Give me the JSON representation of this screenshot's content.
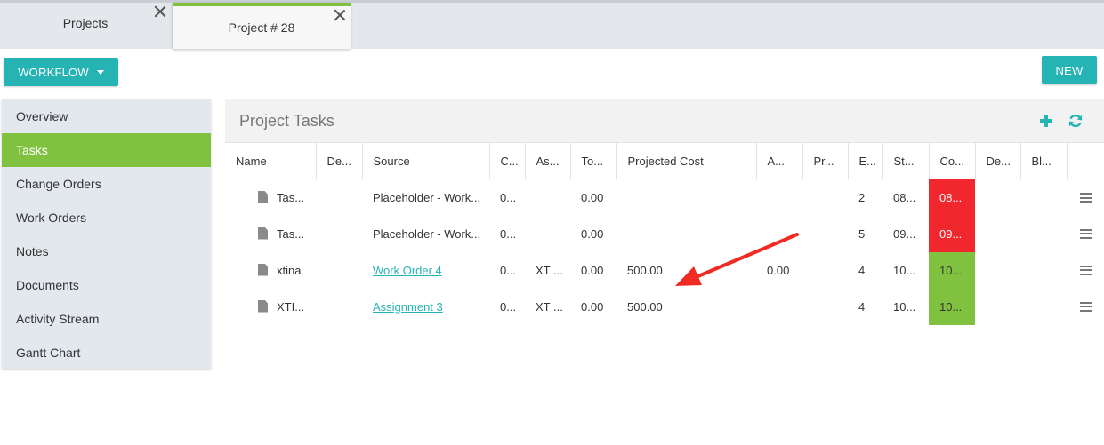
{
  "tabs": [
    {
      "label": "Projects"
    },
    {
      "label": "Project # 28"
    }
  ],
  "toolbar": {
    "workflow_label": "WORKFLOW",
    "new_label": "NEW"
  },
  "sidebar": {
    "items": [
      {
        "label": "Overview"
      },
      {
        "label": "Tasks"
      },
      {
        "label": "Change Orders"
      },
      {
        "label": "Work Orders"
      },
      {
        "label": "Notes"
      },
      {
        "label": "Documents"
      },
      {
        "label": "Activity Stream"
      },
      {
        "label": "Gantt Chart"
      }
    ],
    "active_index": 1
  },
  "panel": {
    "title": "Project Tasks"
  },
  "table": {
    "columns": [
      "Name",
      "De...",
      "Source",
      "C...",
      "As...",
      "To...",
      "Projected Cost",
      "A...",
      "Pr...",
      "E...",
      "St...",
      "Co...",
      "De...",
      "Bl..."
    ],
    "rows": [
      {
        "name": "Tas...",
        "source": "Placeholder - Work...",
        "source_link": false,
        "c": "0...",
        "as": "",
        "to": "0.00",
        "projected_cost": "",
        "a": "",
        "e": "2",
        "st": "08...",
        "co": "08...",
        "co_status": "red"
      },
      {
        "name": "Tas...",
        "source": "Placeholder - Work...",
        "source_link": false,
        "c": "0...",
        "as": "",
        "to": "0.00",
        "projected_cost": "",
        "a": "",
        "e": "5",
        "st": "09...",
        "co": "09...",
        "co_status": "red"
      },
      {
        "name": "xtina",
        "source": "Work Order 4",
        "source_link": true,
        "c": "0...",
        "as": "XT ...",
        "to": "0.00",
        "projected_cost": "500.00",
        "a": "0.00",
        "e": "4",
        "st": "10...",
        "co": "10...",
        "co_status": "green"
      },
      {
        "name": "XTI...",
        "source": "Assignment 3",
        "source_link": true,
        "c": "0...",
        "as": "XT ...",
        "to": "0.00",
        "projected_cost": "500.00",
        "a": "",
        "e": "4",
        "st": "10...",
        "co": "10...",
        "co_status": "green"
      }
    ]
  },
  "colors": {
    "accent": "#26b3b4",
    "active": "#80c23f",
    "status_red": "#f0282d",
    "status_green": "#80c23f",
    "annotation_arrow": "#f02b24"
  }
}
